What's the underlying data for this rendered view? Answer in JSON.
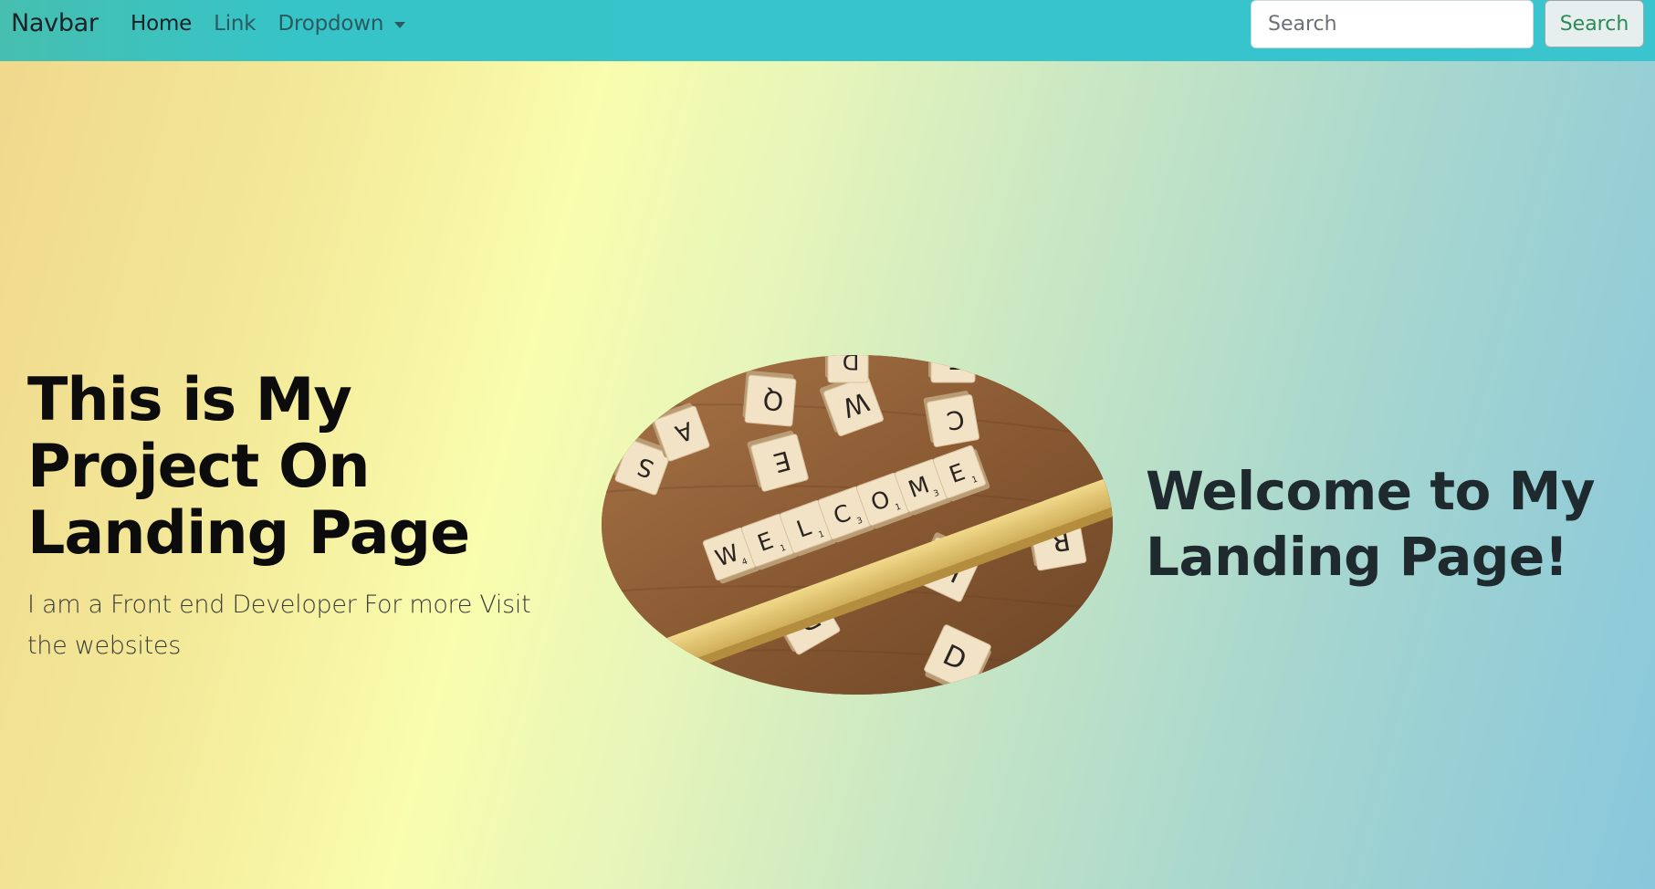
{
  "navbar": {
    "brand": "Navbar",
    "links": [
      {
        "label": "Home",
        "active": true
      },
      {
        "label": "Link",
        "active": false
      },
      {
        "label": "Dropdown",
        "active": false
      }
    ],
    "search": {
      "placeholder": "Search",
      "value": "",
      "button_label": "Search"
    },
    "color": "#38c3cb"
  },
  "hero": {
    "title": "This is My Project On Landing Page",
    "subtitle": "I am a Front end Developer For more Visit the websites",
    "welcome_heading": "Welcome to My Landing Page!"
  },
  "image": {
    "tile_word": [
      "W",
      "E",
      "L",
      "C",
      "O",
      "M",
      "E"
    ],
    "tile_scores": [
      "4",
      "1",
      "1",
      "3",
      "1",
      "3",
      "1"
    ],
    "scattered_tiles": [
      "S",
      "A",
      "Q",
      "W",
      "C",
      "E",
      "E",
      "R",
      "H",
      "D",
      "D",
      "D"
    ]
  }
}
